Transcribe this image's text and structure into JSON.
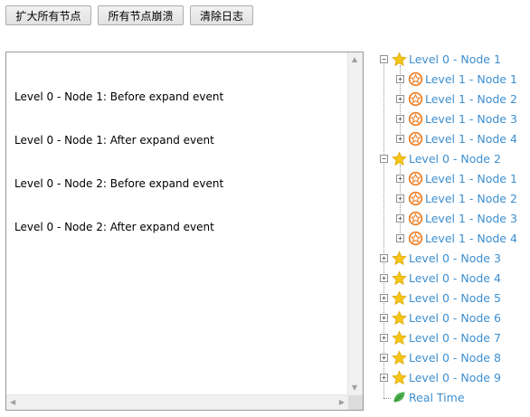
{
  "toolbar": {
    "expand_all_label": "扩大所有节点",
    "collapse_all_label": "所有节点崩溃",
    "clear_log_label": "清除日志"
  },
  "log": {
    "lines": [
      "Level 0 - Node 1: Before expand event",
      "Level 0 - Node 1: After expand event",
      "Level 0 - Node 2: Before expand event",
      "Level 0 - Node 2: After expand event"
    ]
  },
  "colors": {
    "link": "#3d8fd1",
    "star": "#f5c518",
    "badge": "#ee7d22",
    "leaf": "#4caf50"
  },
  "tree": {
    "nodes": [
      {
        "label": "Level 0 - Node 1",
        "level": 0,
        "icon": "star-icon",
        "toggle": "collapse"
      },
      {
        "label": "Level 1 - Node 1",
        "level": 1,
        "icon": "badge-icon",
        "toggle": "expand"
      },
      {
        "label": "Level 1 - Node 2",
        "level": 1,
        "icon": "badge-icon",
        "toggle": "expand"
      },
      {
        "label": "Level 1 - Node 3",
        "level": 1,
        "icon": "badge-icon",
        "toggle": "expand"
      },
      {
        "label": "Level 1 - Node 4",
        "level": 1,
        "icon": "badge-icon",
        "toggle": "expand"
      },
      {
        "label": "Level 0 - Node 2",
        "level": 0,
        "icon": "star-icon",
        "toggle": "collapse"
      },
      {
        "label": "Level 1 - Node 1",
        "level": 1,
        "icon": "badge-icon",
        "toggle": "expand"
      },
      {
        "label": "Level 1 - Node 2",
        "level": 1,
        "icon": "badge-icon",
        "toggle": "expand"
      },
      {
        "label": "Level 1 - Node 3",
        "level": 1,
        "icon": "badge-icon",
        "toggle": "expand"
      },
      {
        "label": "Level 1 - Node 4",
        "level": 1,
        "icon": "badge-icon",
        "toggle": "expand"
      },
      {
        "label": "Level 0 - Node 3",
        "level": 0,
        "icon": "star-icon",
        "toggle": "expand"
      },
      {
        "label": "Level 0 - Node 4",
        "level": 0,
        "icon": "star-icon",
        "toggle": "expand"
      },
      {
        "label": "Level 0 - Node 5",
        "level": 0,
        "icon": "star-icon",
        "toggle": "expand"
      },
      {
        "label": "Level 0 - Node 6",
        "level": 0,
        "icon": "star-icon",
        "toggle": "expand"
      },
      {
        "label": "Level 0 - Node 7",
        "level": 0,
        "icon": "star-icon",
        "toggle": "expand"
      },
      {
        "label": "Level 0 - Node 8",
        "level": 0,
        "icon": "star-icon",
        "toggle": "expand"
      },
      {
        "label": "Level 0 - Node 9",
        "level": 0,
        "icon": "star-icon",
        "toggle": "expand"
      },
      {
        "label": "Real Time",
        "level": 0,
        "icon": "leaf-icon",
        "toggle": "none"
      }
    ]
  }
}
